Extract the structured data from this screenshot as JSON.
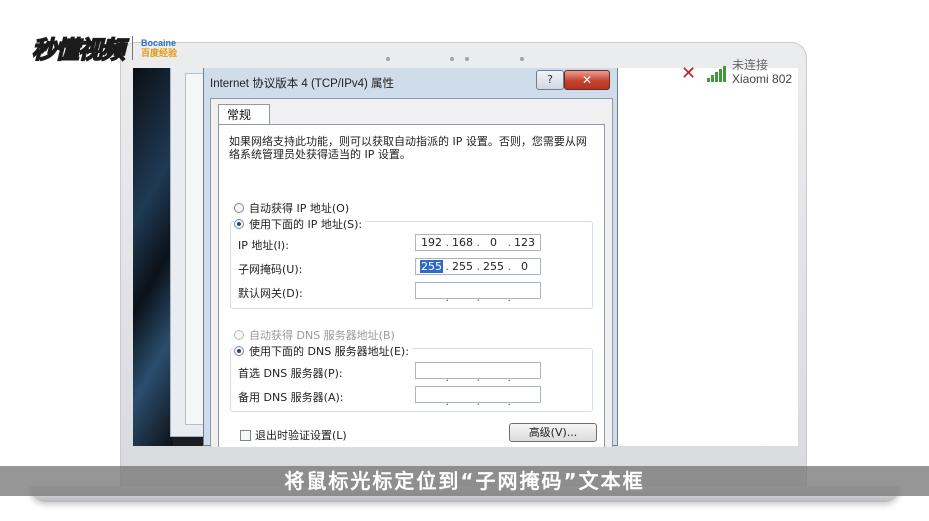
{
  "watermark": {
    "brand_text": "秒懂视频",
    "partner_top": "Bocaine",
    "partner_bottom": "百度经验"
  },
  "network_panel": {
    "status": "未连接",
    "network_name": "Xiaomi 802"
  },
  "dialog": {
    "title": "Internet 协议版本 4 (TCP/IPv4) 属性",
    "help_label": "?",
    "close_label": "✕",
    "tab_general": "常规",
    "description": "如果网络支持此功能，则可以获取自动指派的 IP 设置。否则，您需要从网络系统管理员处获得适当的 IP 设置。",
    "ip_section": {
      "auto_label": "自动获得 IP 地址(O)",
      "manual_label": "使用下面的 IP 地址(S):",
      "selected": "manual",
      "ip_address_label": "IP 地址(I):",
      "ip_address": [
        "192",
        "168",
        "0",
        "123"
      ],
      "subnet_label": "子网掩码(U):",
      "subnet_mask": [
        "255",
        "255",
        "255",
        "0"
      ],
      "subnet_selected_octet": "255",
      "gateway_label": "默认网关(D):",
      "gateway": [
        "",
        "",
        "",
        ""
      ]
    },
    "dns_section": {
      "auto_label": "自动获得 DNS 服务器地址(B)",
      "manual_label": "使用下面的 DNS 服务器地址(E):",
      "selected": "manual",
      "preferred_label": "首选 DNS 服务器(P):",
      "preferred": [
        "",
        "",
        "",
        ""
      ],
      "alternate_label": "备用 DNS 服务器(A):",
      "alternate": [
        "",
        "",
        "",
        ""
      ]
    },
    "validate_on_exit_label": "退出时验证设置(L)",
    "advanced_label": "高级(V)..."
  },
  "caption": "将鼠标光标定位到“子网掩码”文本框"
}
